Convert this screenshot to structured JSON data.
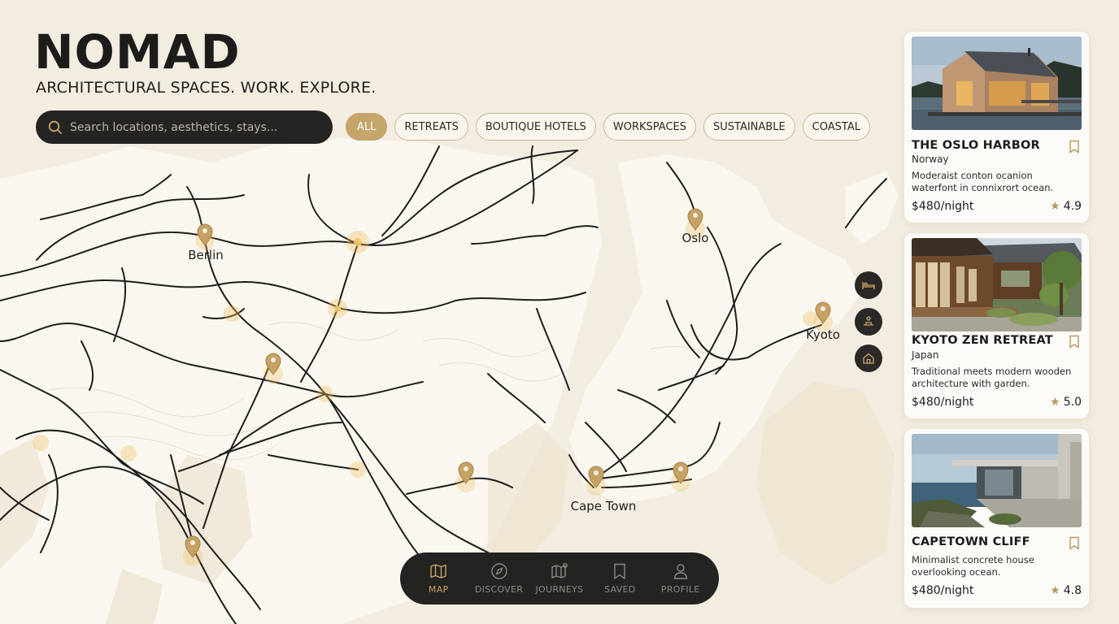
{
  "app": {
    "brand": "NOMAD",
    "tagline": "ARCHITECTURAL SPACES. WORK. EXPLORE."
  },
  "search": {
    "placeholder": "Search locations, aesthetics, stays..."
  },
  "filters": [
    {
      "label": "ALL",
      "active": true
    },
    {
      "label": "RETREATS",
      "active": false
    },
    {
      "label": "BOUTIQUE HOTELS",
      "active": false
    },
    {
      "label": "WORKSPACES",
      "active": false
    },
    {
      "label": "SUSTAINABLE",
      "active": false
    },
    {
      "label": "COASTAL",
      "active": false
    }
  ],
  "map": {
    "labels": {
      "berlin": "Berlin",
      "oslo": "Oslo",
      "kyoto": "Kyoto",
      "cape_town": "Cape Town"
    }
  },
  "tools": [
    {
      "icon": "bed-icon"
    },
    {
      "icon": "workspace-icon"
    },
    {
      "icon": "home-icon"
    }
  ],
  "listings": [
    {
      "title": "THE OSLO HARBOR",
      "country": "Norway",
      "description": "Moderaist conton ocanion waterfont in connixrort ocean.",
      "price": "$480/night",
      "rating": "4.9"
    },
    {
      "title": "KYOTO ZEN RETREAT",
      "country": "Japan",
      "description": "Traditional meets modern wooden architecture with garden.",
      "price": "$480/night",
      "rating": "5.0"
    },
    {
      "title": "CAPETOWN CLIFF",
      "country": "",
      "description": "Minimalist concrete house overlooking ocean.",
      "price": "$480/night",
      "rating": "4.8"
    }
  ],
  "nav": [
    {
      "label": "MAP",
      "icon": "map-icon",
      "active": true
    },
    {
      "label": "DISCOVER",
      "icon": "compass-icon",
      "active": false
    },
    {
      "label": "JOURNEYS",
      "icon": "journeys-icon",
      "active": false
    },
    {
      "label": "SAVED",
      "icon": "bookmark-icon",
      "active": false
    },
    {
      "label": "PROFILE",
      "icon": "profile-icon",
      "active": false
    }
  ],
  "colors": {
    "background": "#f3ede1",
    "accent": "#c5a56a",
    "dark": "#232322"
  }
}
